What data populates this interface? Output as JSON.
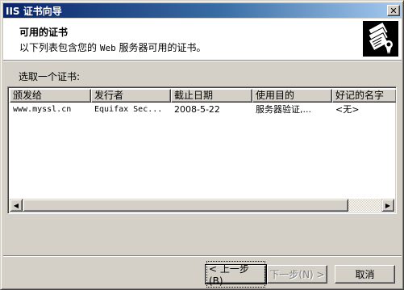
{
  "window": {
    "title": "IIS 证书向导",
    "close_symbol": "✕"
  },
  "header": {
    "title": "可用的证书",
    "subtitle_pre": "以下列表包含您的 ",
    "subtitle_web": "Web",
    "subtitle_post": " 服务器可用的证书。",
    "icon": "certificates-icon"
  },
  "select_label": "选取一个证书:",
  "list": {
    "columns": [
      "颁发给",
      "发行者",
      "截止日期",
      "使用目的",
      "好记的名字"
    ],
    "rows": [
      [
        "www.myssl.cn",
        "Equifax Sec...",
        "2008-5-22",
        "服务器验证,...",
        "<无>"
      ]
    ]
  },
  "scrollbar": {
    "left_arrow": "◀",
    "right_arrow": "▶"
  },
  "buttons": {
    "back": "< 上一步(B)",
    "next": "下一步(N) >",
    "cancel": "取消"
  }
}
